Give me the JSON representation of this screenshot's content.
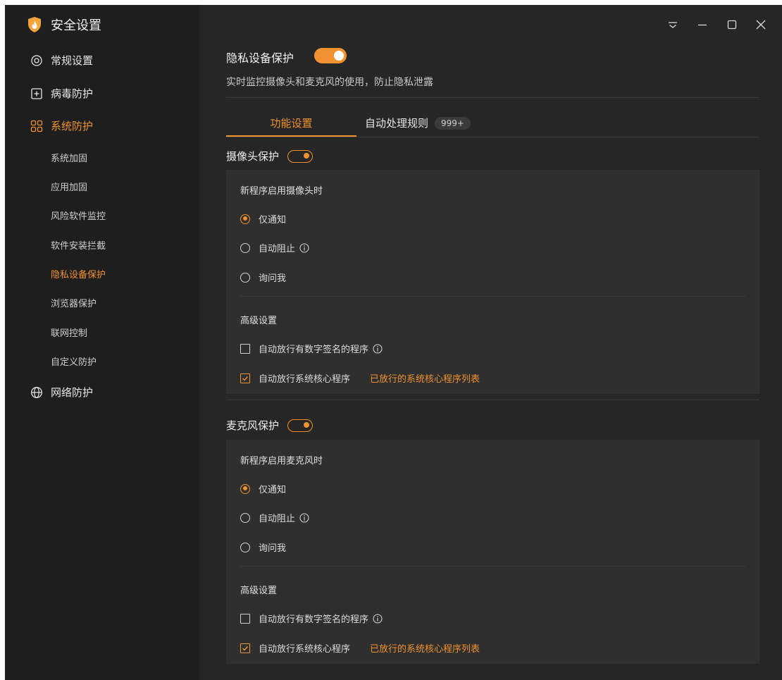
{
  "app": {
    "title": "安全设置",
    "logo_icon": "shield-flame-logo"
  },
  "colors": {
    "accent": "#f0922f",
    "background": "#262626",
    "sidebar": "#1e1e1e",
    "panel": "#2f2f2f"
  },
  "window_controls": {
    "menu_icon": "dropdown-menu-icon",
    "minimize_icon": "minimize-icon",
    "maximize_icon": "maximize-icon",
    "close_icon": "close-icon"
  },
  "sidebar": {
    "items": [
      {
        "label": "常规设置",
        "icon": "gear-icon"
      },
      {
        "label": "病毒防护",
        "icon": "plus-box-icon"
      },
      {
        "label": "系统防护",
        "icon": "grid-icon",
        "active": true
      },
      {
        "label": "网络防护",
        "icon": "globe-icon"
      }
    ],
    "subitems": [
      {
        "label": "系统加固"
      },
      {
        "label": "应用加固"
      },
      {
        "label": "风险软件监控"
      },
      {
        "label": "软件安装拦截"
      },
      {
        "label": "隐私设备保护",
        "active": true
      },
      {
        "label": "浏览器保护"
      },
      {
        "label": "联网控制"
      },
      {
        "label": "自定义防护"
      }
    ]
  },
  "header": {
    "title": "隐私设备保护",
    "toggle_on": true,
    "subtitle": "实时监控摄像头和麦克风的使用，防止隐私泄露"
  },
  "tabs": [
    {
      "label": "功能设置",
      "active": true
    },
    {
      "label": "自动处理规则",
      "badge": "999+"
    }
  ],
  "camera": {
    "title": "摄像头保护",
    "toggle_on": true,
    "question": "新程序启用摄像头时",
    "options": [
      {
        "label": "仅通知",
        "selected": true
      },
      {
        "label": "自动阻止",
        "info": true
      },
      {
        "label": "询问我"
      }
    ],
    "advanced_title": "高级设置",
    "checks": [
      {
        "label": "自动放行有数字签名的程序",
        "checked": false,
        "info": true
      },
      {
        "label": "自动放行系统核心程序",
        "checked": true,
        "link": "已放行的系统核心程序列表"
      }
    ]
  },
  "mic": {
    "title": "麦克风保护",
    "toggle_on": true,
    "question": "新程序启用麦克风时",
    "options": [
      {
        "label": "仅通知",
        "selected": true
      },
      {
        "label": "自动阻止",
        "info": true
      },
      {
        "label": "询问我"
      }
    ],
    "advanced_title": "高级设置",
    "checks": [
      {
        "label": "自动放行有数字签名的程序",
        "checked": false,
        "info": true
      },
      {
        "label": "自动放行系统核心程序",
        "checked": true,
        "link": "已放行的系统核心程序列表"
      }
    ]
  }
}
